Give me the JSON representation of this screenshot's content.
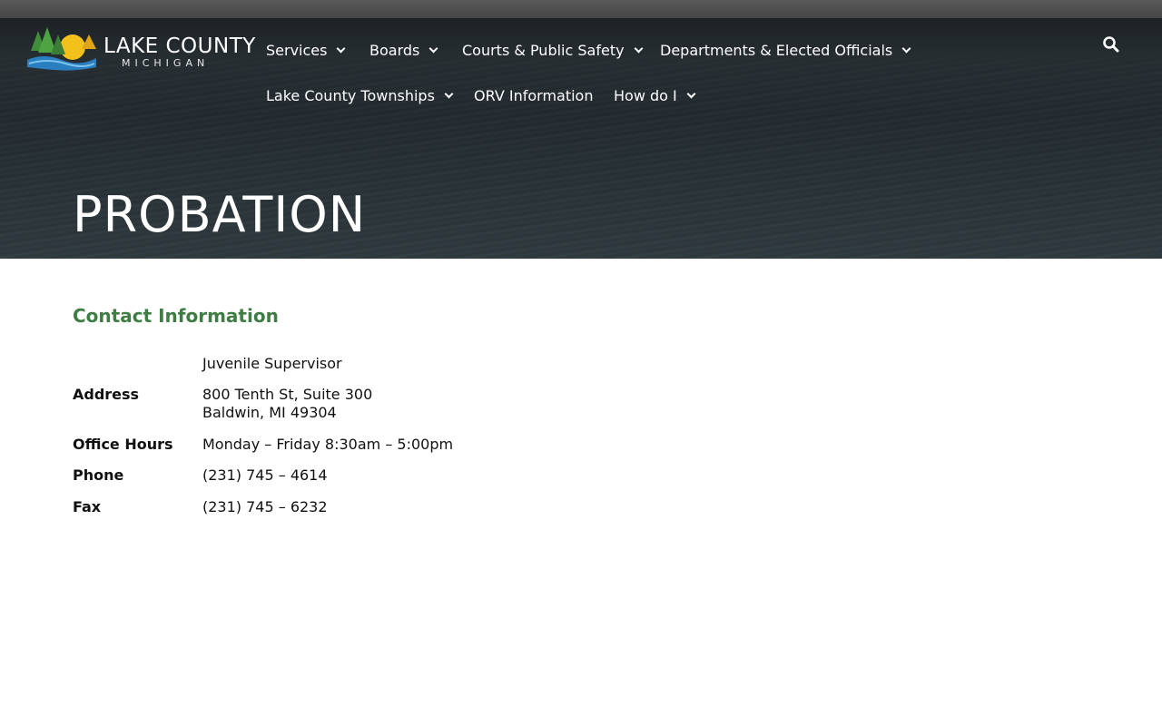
{
  "logo": {
    "name": "LAKE COUNTY",
    "sub": "MICHIGAN"
  },
  "nav": {
    "items": [
      {
        "label": "Services",
        "dropdown": true
      },
      {
        "label": "Boards",
        "dropdown": true
      },
      {
        "label": "Courts & Public Safety",
        "dropdown": true
      },
      {
        "label": "Departments & Elected Officials",
        "dropdown": true
      },
      {
        "label": "Lake County Townships",
        "dropdown": true
      },
      {
        "label": "ORV Information",
        "dropdown": false
      },
      {
        "label": "How do I",
        "dropdown": true
      }
    ],
    "search_icon": "search-icon"
  },
  "page": {
    "title": "PROBATION"
  },
  "contact": {
    "title": "Contact Information",
    "role": "Juvenile Supervisor",
    "rows": [
      {
        "label": "Address",
        "line1": "800 Tenth St, Suite 300",
        "line2": "Baldwin, MI 49304"
      },
      {
        "label": "Office Hours",
        "line1": "Monday – Friday 8:30am – 5:00pm"
      },
      {
        "label": "Phone",
        "line1": "(231) 745 – 4614"
      },
      {
        "label": "Fax",
        "line1": "(231) 745 – 6232"
      }
    ]
  },
  "colors": {
    "accent_green": "#3e7d43",
    "hero_dark": "#2f393e"
  }
}
